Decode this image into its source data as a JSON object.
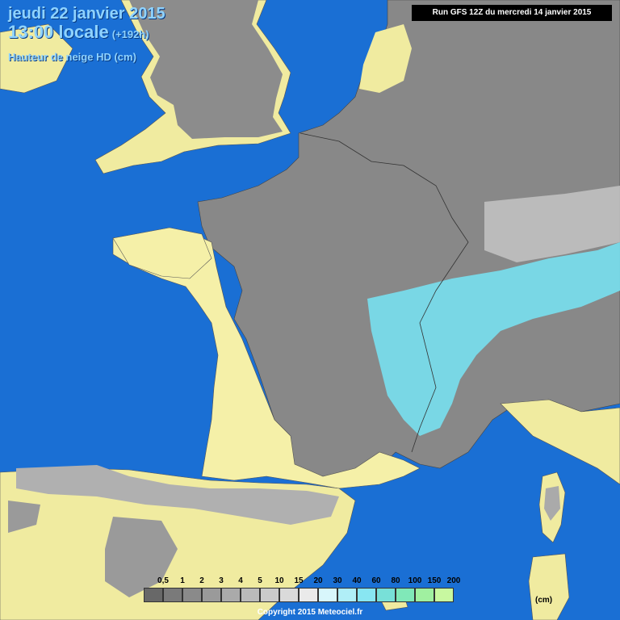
{
  "header": {
    "date": "jeudi 22 janvier 2015",
    "time": "13:00 locale",
    "lead": "(+192h)",
    "parameter": "Hauteur de neige HD (cm)"
  },
  "run_info": "Run GFS 12Z du mercredi 14 janvier 2015",
  "legend": {
    "labels": [
      "0,5",
      "1",
      "2",
      "3",
      "4",
      "5",
      "10",
      "15",
      "20",
      "30",
      "40",
      "60",
      "80",
      "100",
      "150",
      "200"
    ],
    "colors": [
      "#686868",
      "#7a7a7a",
      "#8a8a8a",
      "#9a9a9a",
      "#aaaaaa",
      "#bababa",
      "#cacaca",
      "#dadada",
      "#eaeaea",
      "#d8f6fb",
      "#b0eef7",
      "#88e6f2",
      "#78e0d8",
      "#80e8b8",
      "#a0f0a0",
      "#c8f8a0"
    ],
    "unit": "(cm)"
  },
  "copyright": "Copyright 2015 Meteociel.fr",
  "colors": {
    "sea": "#1a6fd4",
    "land_no_snow": "#f5f0a8",
    "land_snow_low": "#8a8a8a",
    "land_snow_mid": "#bababa",
    "snow_high": "#78e0f0"
  }
}
